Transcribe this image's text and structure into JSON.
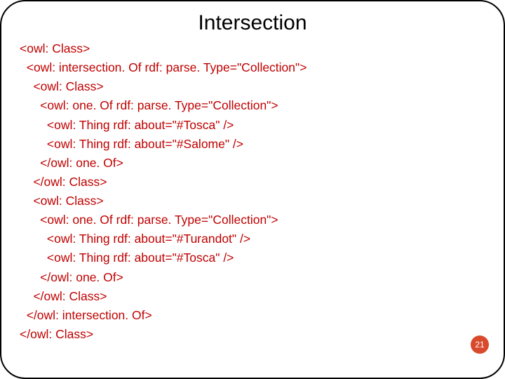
{
  "title": "Intersection",
  "code": "<owl: Class>\n  <owl: intersection. Of rdf: parse. Type=\"Collection\">\n    <owl: Class>\n      <owl: one. Of rdf: parse. Type=\"Collection\">\n        <owl: Thing rdf: about=\"#Tosca\" />\n        <owl: Thing rdf: about=\"#Salome\" />\n      </owl: one. Of>\n    </owl: Class>\n    <owl: Class>\n      <owl: one. Of rdf: parse. Type=\"Collection\">\n        <owl: Thing rdf: about=\"#Turandot\" />\n        <owl: Thing rdf: about=\"#Tosca\" />\n      </owl: one. Of>\n    </owl: Class>\n  </owl: intersection. Of>\n</owl: Class>",
  "page_number": "21"
}
